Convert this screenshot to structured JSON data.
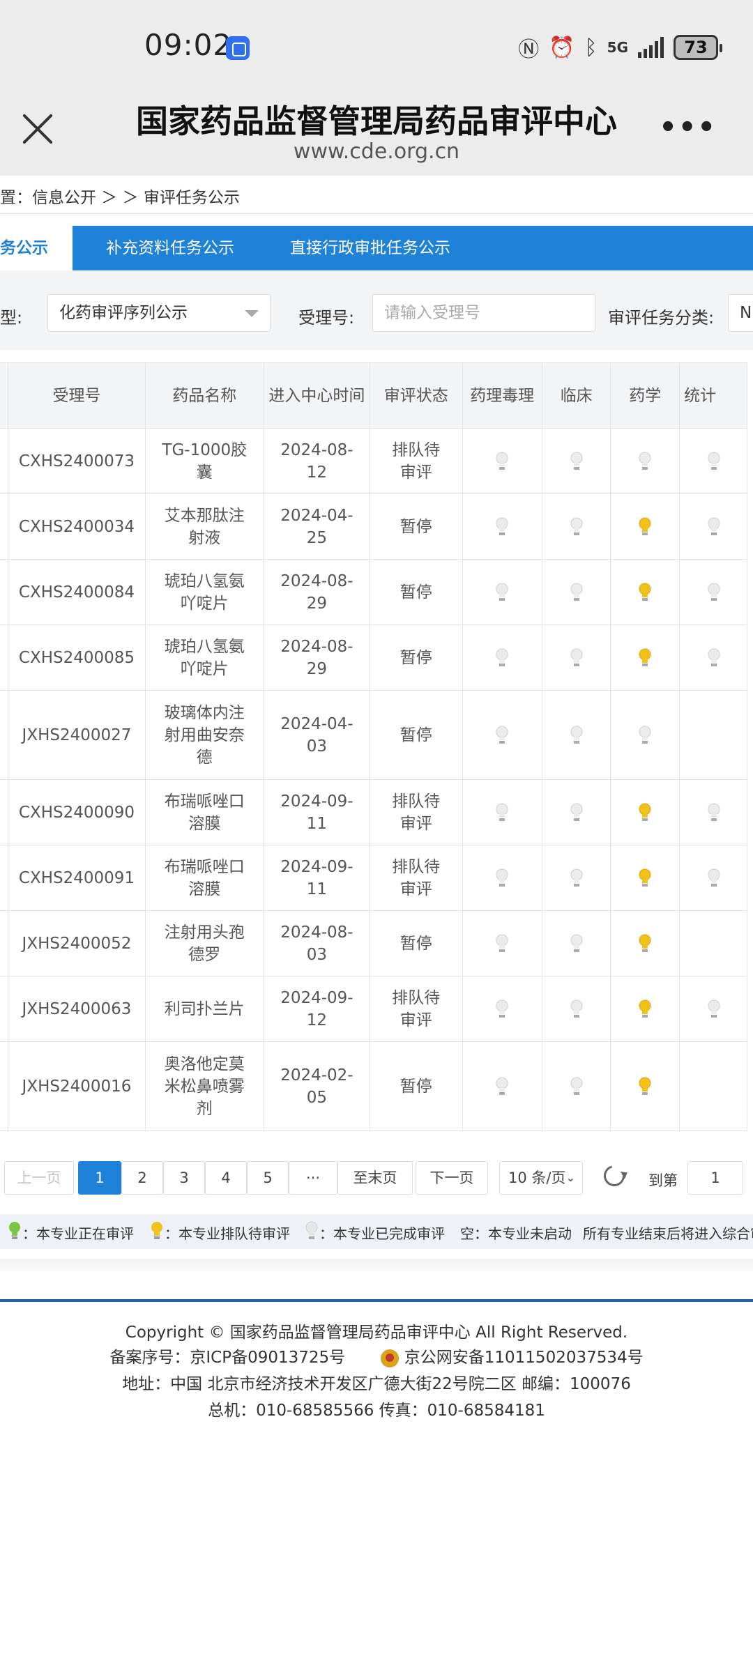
{
  "status_bar": {
    "time": "09:02",
    "battery": "73",
    "network": "5G"
  },
  "header": {
    "title": "国家药品监督管理局药品审评中心",
    "url": "www.cde.org.cn",
    "more": "•••"
  },
  "breadcrumb": "置：信息公开 ＞ ＞ 审评任务公示",
  "tabs": [
    "务公示",
    "补充资料任务公示",
    "直接行政审批任务公示"
  ],
  "filter": {
    "type_label": "型:",
    "type_value": "化药审评序列公示",
    "acceptance_label": "受理号:",
    "acceptance_placeholder": "请输入受理号",
    "category_label": "审评任务分类:",
    "category_value": "N"
  },
  "table": {
    "headers": [
      "受理号",
      "药品名称",
      "进入中心时间",
      "审评状态",
      "药理毒理",
      "临床",
      "药学",
      "统计"
    ],
    "rows": [
      {
        "id": "CXHS2400073",
        "name": "TG-1000胶囊",
        "date": "2024-08-12",
        "status": "排队待审评",
        "lights": [
          "done",
          "done",
          "done",
          "done"
        ]
      },
      {
        "id": "CXHS2400034",
        "name": "艾本那肽注射液",
        "date": "2024-04-25",
        "status": "暂停",
        "lights": [
          "done",
          "done",
          "queue",
          "done"
        ]
      },
      {
        "id": "CXHS2400084",
        "name": "琥珀八氢氨吖啶片",
        "date": "2024-08-29",
        "status": "暂停",
        "lights": [
          "done",
          "done",
          "queue",
          "done"
        ]
      },
      {
        "id": "CXHS2400085",
        "name": "琥珀八氢氨吖啶片",
        "date": "2024-08-29",
        "status": "暂停",
        "lights": [
          "done",
          "done",
          "queue",
          "done"
        ]
      },
      {
        "id": "JXHS2400027",
        "name": "玻璃体内注射用曲安奈德",
        "date": "2024-04-03",
        "status": "暂停",
        "lights": [
          "done",
          "done",
          "done",
          "none"
        ]
      },
      {
        "id": "CXHS2400090",
        "name": "布瑞哌唑口溶膜",
        "date": "2024-09-11",
        "status": "排队待审评",
        "lights": [
          "done",
          "done",
          "queue",
          "done"
        ]
      },
      {
        "id": "CXHS2400091",
        "name": "布瑞哌唑口溶膜",
        "date": "2024-09-11",
        "status": "排队待审评",
        "lights": [
          "done",
          "done",
          "queue",
          "done"
        ]
      },
      {
        "id": "JXHS2400052",
        "name": "注射用头孢德罗",
        "date": "2024-08-03",
        "status": "暂停",
        "lights": [
          "done",
          "done",
          "queue",
          "none"
        ]
      },
      {
        "id": "JXHS2400063",
        "name": "利司扑兰片",
        "date": "2024-09-12",
        "status": "排队待审评",
        "lights": [
          "done",
          "done",
          "queue",
          "done"
        ]
      },
      {
        "id": "JXHS2400016",
        "name": "奥洛他定莫米松鼻喷雾剂",
        "date": "2024-02-05",
        "status": "暂停",
        "lights": [
          "done",
          "done",
          "queue",
          "none"
        ]
      }
    ]
  },
  "pagination": {
    "prev": "上一页",
    "pages": [
      "1",
      "2",
      "3",
      "4",
      "5"
    ],
    "ellipsis": "···",
    "last": "至末页",
    "next": "下一页",
    "page_size": "10 条/页",
    "goto_label": "到第",
    "goto_value": "1",
    "current_page": 1
  },
  "legend": {
    "in_review": "：本专业正在审评",
    "queued": "：本专业排队待审评",
    "completed": "：本专业已完成审评",
    "not_started": "空：本专业未启动",
    "note": "所有专业结束后将进入综合审"
  },
  "colors": {
    "brand_blue": "#1e82d8",
    "bulb_green": "#7cc544",
    "bulb_yellow": "#f2c21b",
    "bulb_white": "#d9d9d9"
  },
  "footer": {
    "copyright": "Copyright © 国家药品监督管理局药品审评中心   All Right Reserved.",
    "icp": "备案序号：京ICP备09013725号",
    "police": "京公网安备11011502037534号",
    "address": "地址：中国 北京市经济技术开发区广德大街22号院二区      邮编：100076",
    "phone": "总机：010-68585566      传真：010-68584181"
  }
}
